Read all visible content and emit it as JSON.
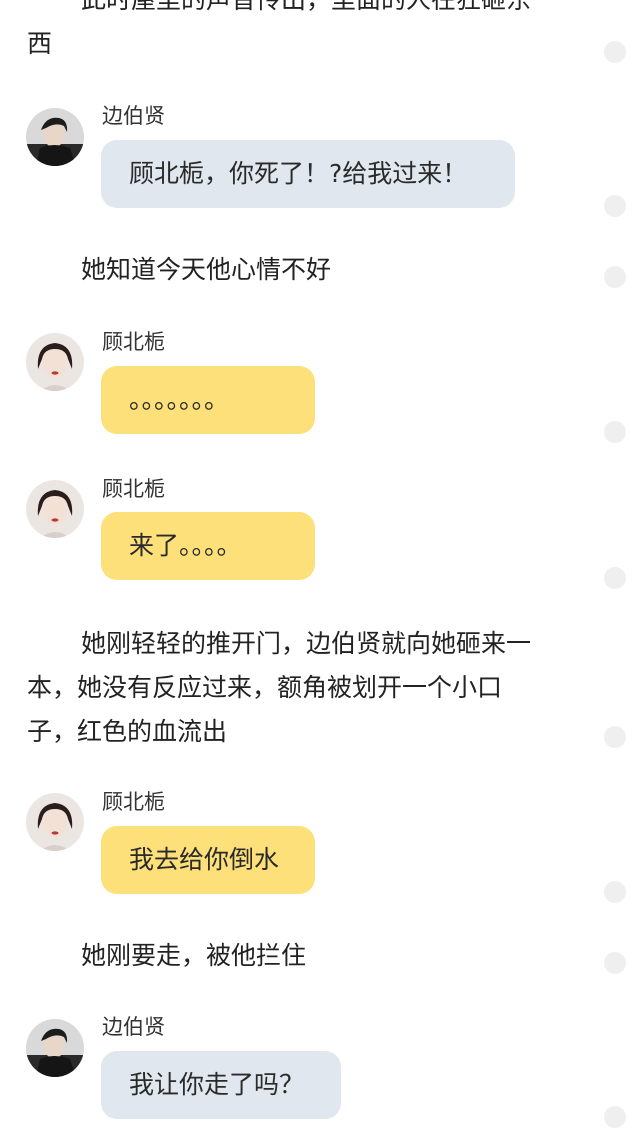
{
  "narration": {
    "top_line_partial": "此时屋里的声音传出，里面的人在狂砸东",
    "top_line_end": "西",
    "p1": "她知道今天他心情不好",
    "p2_line1": "她刚轻轻的推开门，边伯贤就向她砸来一",
    "p2_line2": "本，她没有反应过来，额角被划开一个小口",
    "p2_line3": "子，红色的血流出",
    "p3": "她刚要走，被他拦住"
  },
  "messages": [
    {
      "speaker": "边伯贤",
      "text": "顾北栀，你死了！?给我过来！"
    },
    {
      "speaker": "顾北栀",
      "text": "。。。。。。。"
    },
    {
      "speaker": "顾北栀",
      "text": "来了。。。。"
    },
    {
      "speaker": "顾北栀",
      "text": "我去给你倒水"
    },
    {
      "speaker": "边伯贤",
      "text": "我让你走了吗？"
    }
  ],
  "colors": {
    "male_bubble": "#e1e7ef",
    "female_bubble": "#fde07a",
    "scroll_dot": "#efefef"
  },
  "icons": {
    "male_avatar": "male-avatar-icon",
    "female_avatar": "female-avatar-icon"
  }
}
